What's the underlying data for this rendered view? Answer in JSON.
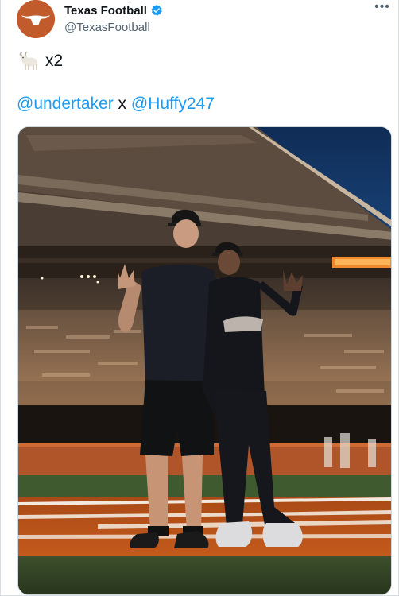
{
  "tweet": {
    "author": {
      "display_name": "Texas Football",
      "handle": "@TexasFootball",
      "verified": true,
      "avatar_icon": "longhorn-icon",
      "avatar_color": "#c15b2b"
    },
    "more_icon": "more-dots-icon",
    "text_line1": {
      "emoji_icon": "goat-icon",
      "suffix": "x2"
    },
    "text_line2": {
      "mention1": "@undertaker",
      "joiner": " x ",
      "mention2": "@Huffy247"
    },
    "media": {
      "description_icon": "photo",
      "link_color": "#1d9bf0"
    }
  }
}
